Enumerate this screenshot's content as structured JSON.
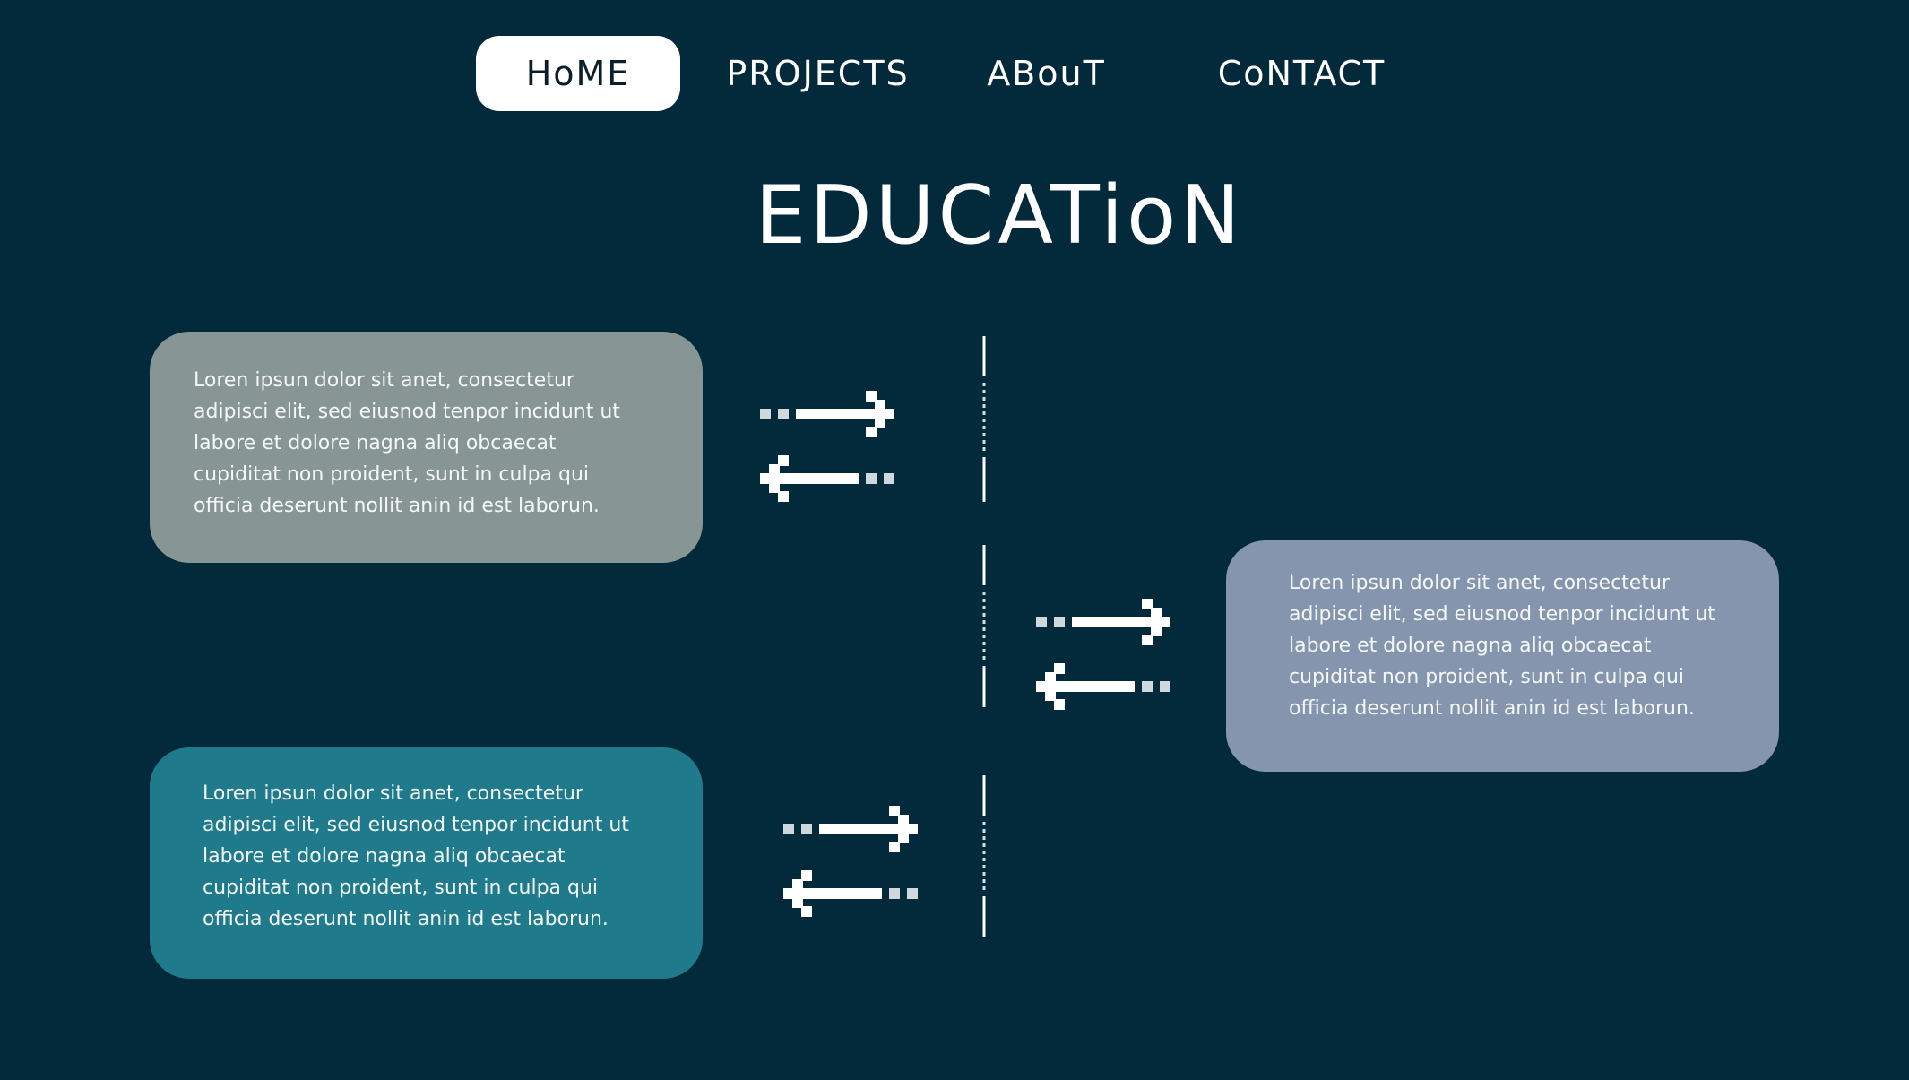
{
  "nav": {
    "home": "HoME",
    "projects": "PROJECTS",
    "about": "ABouT",
    "contact": "CoNTACT"
  },
  "page": {
    "title": "EDUCATioN"
  },
  "entries": [
    {
      "text": "Loren ipsun dolor sit anet, consectetur adipisci elit, sed eiusnod tenpor incidunt ut labore et dolore nagna aliq obcaecat cupiditat non proident, sunt in culpa qui officia deserunt nollit anin id est laborun.",
      "color": "#879594"
    },
    {
      "text": "Loren ipsun dolor sit anet, consectetur adipisci elit, sed eiusnod tenpor incidunt ut labore et dolore nagna aliq obcaecat cupiditat non proident, sunt in culpa qui officia deserunt nollit anin id est laborun.",
      "color": "#8595ae"
    },
    {
      "text": "Loren ipsun dolor sit anet, consectetur adipisci elit, sed eiusnod tenpor incidunt ut labore et dolore nagna aliq obcaecat cupiditat non proident, sunt in culpa qui officia deserunt nollit anin id est laborun.",
      "color": "#1f7a8c"
    }
  ],
  "icons": {
    "exchange": "exchange-arrows-icon",
    "timeline": "dashed-timeline-line"
  },
  "colors": {
    "background": "#022a3b",
    "nav_active_bg": "#ffffff"
  }
}
